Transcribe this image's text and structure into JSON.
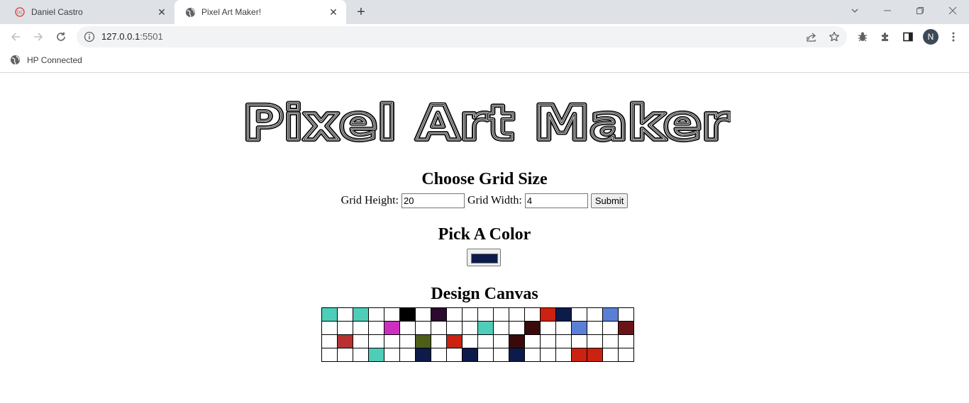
{
  "browser": {
    "tabs": [
      {
        "title": "Daniel Castro",
        "active": false
      },
      {
        "title": "Pixel Art Maker!",
        "active": true
      }
    ],
    "url": {
      "host": "127.0.0.1",
      "port": ":5501"
    },
    "bookmarks": [
      {
        "label": "HP Connected"
      }
    ],
    "profile_initial": "N"
  },
  "page": {
    "logo_text": "Pixel Art Maker",
    "grid_heading": "Choose Grid Size",
    "height_label": "Grid Height:",
    "height_value": "20",
    "width_label": "Grid Width:",
    "width_value": "4",
    "submit_label": "Submit",
    "color_heading": "Pick A Color",
    "selected_color": "#0d1b4a",
    "canvas_heading": "Design Canvas"
  },
  "canvas": {
    "rows": 4,
    "cols": 20,
    "cells": [
      [
        "#4ecdb9",
        "#ffffff",
        "#4ecdb9",
        "#ffffff",
        "#ffffff",
        "#000000",
        "#ffffff",
        "#2a0a2e",
        "#ffffff",
        "#ffffff",
        "#ffffff",
        "#ffffff",
        "#ffffff",
        "#ffffff",
        "#cc2211",
        "#0d1b4a",
        "#ffffff",
        "#ffffff",
        "#5b7fd6",
        "#ffffff"
      ],
      [
        "#ffffff",
        "#ffffff",
        "#ffffff",
        "#ffffff",
        "#cc2fc0",
        "#ffffff",
        "#ffffff",
        "#ffffff",
        "#ffffff",
        "#ffffff",
        "#4ecdb9",
        "#ffffff",
        "#ffffff",
        "#3a0a0a",
        "#ffffff",
        "#ffffff",
        "#5b7fd6",
        "#ffffff",
        "#ffffff",
        "#6b1418"
      ],
      [
        "#ffffff",
        "#b83232",
        "#ffffff",
        "#ffffff",
        "#ffffff",
        "#ffffff",
        "#4d5e1a",
        "#ffffff",
        "#cc2211",
        "#ffffff",
        "#ffffff",
        "#ffffff",
        "#3a0a0a",
        "#ffffff",
        "#ffffff",
        "#ffffff",
        "#ffffff",
        "#ffffff",
        "#ffffff",
        "#ffffff"
      ],
      [
        "#ffffff",
        "#ffffff",
        "#ffffff",
        "#4ecdb9",
        "#ffffff",
        "#ffffff",
        "#0d1b4a",
        "#ffffff",
        "#ffffff",
        "#0d1b4a",
        "#ffffff",
        "#ffffff",
        "#0d1b4a",
        "#ffffff",
        "#ffffff",
        "#ffffff",
        "#cc2211",
        "#cc2211",
        "#ffffff",
        "#ffffff"
      ]
    ]
  }
}
